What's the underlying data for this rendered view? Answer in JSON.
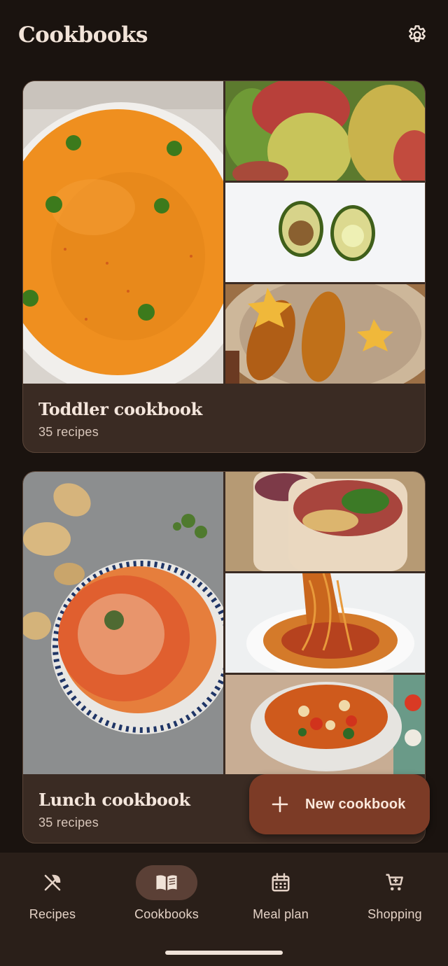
{
  "header": {
    "title": "Cookbooks",
    "settings_icon": "gear-icon"
  },
  "cookbooks": [
    {
      "title": "Toddler cookbook",
      "subtitle": "35 recipes",
      "photos": [
        "carrot-soup-photo",
        "pears-photo",
        "avocado-photo",
        "oatmeal-bowl-photo"
      ]
    },
    {
      "title": "Lunch cookbook",
      "subtitle": "35 recipes",
      "photos": [
        "tomato-soup-photo",
        "wrap-photo",
        "spaghetti-photo",
        "minestrone-photo"
      ]
    }
  ],
  "fab": {
    "label": "New cookbook",
    "icon": "plus-icon"
  },
  "nav": {
    "items": [
      {
        "label": "Recipes",
        "icon": "fork-knife-icon",
        "active": false
      },
      {
        "label": "Cookbooks",
        "icon": "book-icon",
        "active": true
      },
      {
        "label": "Meal plan",
        "icon": "calendar-icon",
        "active": false
      },
      {
        "label": "Shopping",
        "icon": "cart-icon",
        "active": false
      }
    ]
  },
  "colors": {
    "background": "#1a130f",
    "card": "#3a2b23",
    "fab": "#7c3b26",
    "nav_active_pill": "#5b4036"
  }
}
